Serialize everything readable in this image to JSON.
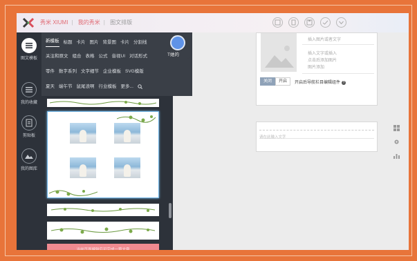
{
  "header": {
    "brand": "秀米 XIUMI",
    "nav": [
      "我的秀米",
      "图文排版"
    ]
  },
  "rail": [
    {
      "label": "图文模板",
      "icon": "menu-icon"
    },
    {
      "label": "我的收藏",
      "icon": "collect-icon"
    },
    {
      "label": "剪贴板",
      "icon": "clipboard-icon"
    },
    {
      "label": "我的图库",
      "icon": "gallery-icon"
    }
  ],
  "menu": {
    "row1": [
      "新模板",
      "标题",
      "卡片",
      "图片",
      "背景图",
      "卡片",
      "分割线"
    ],
    "row2": [
      "关注和原文",
      "组合",
      "表格",
      "公式",
      "音视UI",
      "对话形式"
    ],
    "row3": [
      "零件",
      "数字系列",
      "文字细节",
      "企业模板",
      "SVG模版"
    ],
    "row4": [
      "夏天",
      "端午节",
      "鼠尾浪啊",
      "行业模板",
      "更多..."
    ],
    "badge_label": "T她的"
  },
  "editor": {
    "lines": [
      "插入图片或者文字",
      "插入文字或插入",
      "点击后添加图片",
      "图片添加"
    ]
  },
  "toolbar": {
    "close": "关闭",
    "open": "开启",
    "hint": "开启后导航栏目编辑组件"
  },
  "input": {
    "placeholder": "请在此输入文字"
  },
  "template_list": {
    "footer_bar": "当前页面编辑后可完成一篇文章"
  },
  "colors": {
    "frame": "#e8743a",
    "rail": "#2d323a",
    "menu": "#3a3f47",
    "accent_blue": "#5f93e8",
    "pink_bar": "#f08a90",
    "brand_red": "#e06a74"
  }
}
